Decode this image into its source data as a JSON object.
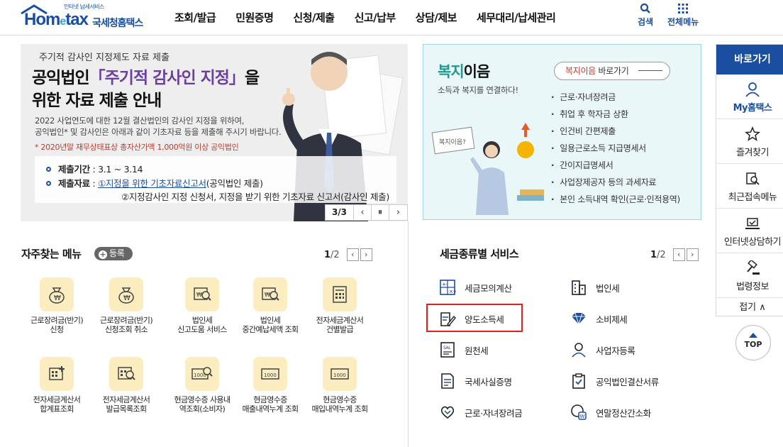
{
  "header": {
    "logo_small": "인터넷 납세서비스",
    "logo_home": "Hom",
    "logo_e": "e",
    "logo_tax": "tax",
    "logo_kr": "국세청홈택스",
    "nav": [
      "조회/발급",
      "민원증명",
      "신청/제출",
      "신고/납부",
      "상담/제보",
      "세무대리/납세관리"
    ],
    "search_label": "검색",
    "allmenu_label": "전체메뉴"
  },
  "banner": {
    "sub": "주기적 감사인 지정제도 자료 제출",
    "title_a": "공익법인",
    "title_hl": "「주기적 감사인 지정」",
    "title_b": "을",
    "title_line2": "위한 자료 제출 안내",
    "desc1": "2022 사업연도에 대한 12월 결산법인의 감사인 지정을 위하여,",
    "desc2": "공익법인* 및 감사인은 아래과 같이 기초자료 등을 제출해 주시기 바랍니다.",
    "note": "* 2020년말 재무상태표상 총자산가액 1,000억원 이상 공익법인",
    "period_label": "제출기간",
    "period_value": ": 3.1 ~ 3.14",
    "data_label": "제출자료",
    "data_link": "①지정을 위한 기초자료신고서",
    "data_value1": "(공익법인 제출)",
    "data_value2": "②지정감사인 지정 신청서, 지정을 받기 위한 기초자료 신고서(감사인 제출)",
    "pager": "3/3"
  },
  "welfare": {
    "title_green": "복지",
    "title_rest": "이음",
    "sub": "소득과 복지를 연결하다!",
    "btn_red": "복지이음",
    "btn_rest": " 바로가기",
    "items": [
      "근로·자녀장려금",
      "취업 후 학자금 상환",
      "인건비 간편제출",
      "일용근로소득 지급명세서",
      "간이지급명세서",
      "사업장제공자 등의 과세자료",
      "본인 소득내역 확인(근로·인적용역)"
    ],
    "sign_text": "복지이음?"
  },
  "rail": {
    "head": "바로가기",
    "items": [
      "My홈택스",
      "즐겨찾기",
      "최근접속메뉴",
      "인터넷상담하기",
      "법령정보"
    ],
    "fold": "접기 ∧",
    "top": "TOP"
  },
  "favorites": {
    "title": "자주찾는 메뉴",
    "add": "등록",
    "page_current": "1",
    "page_total": "/2",
    "items": [
      [
        "근로장려금(반기)",
        "신청"
      ],
      [
        "근로장려금(반기)",
        "신청조회 취소"
      ],
      [
        "법인세",
        "신고도움 서비스"
      ],
      [
        "법인세",
        "중간예납세액 조회"
      ],
      [
        "전자세금계산서",
        "건별발급"
      ],
      [
        "전자세금계산서",
        "합계표조회"
      ],
      [
        "전자세금계산서",
        "발급목록조회"
      ],
      [
        "현금영수증 사용내",
        "역조회(소비자)"
      ],
      [
        "현금영수증",
        "매출내역누계 조회"
      ],
      [
        "현금영수증",
        "매입내역누계 조회"
      ]
    ],
    "icon_text": "1000"
  },
  "taxservices": {
    "title": "세금종류별 서비스",
    "page_current": "1",
    "page_total": "/2",
    "left": [
      "세금모의계산",
      "양도소득세",
      "원천세",
      "국세사실증명",
      "근로·자녀장려금"
    ],
    "right": [
      "법인세",
      "소비제세",
      "사업자등록",
      "공익법인결산서류",
      "연말정산간소화"
    ]
  }
}
